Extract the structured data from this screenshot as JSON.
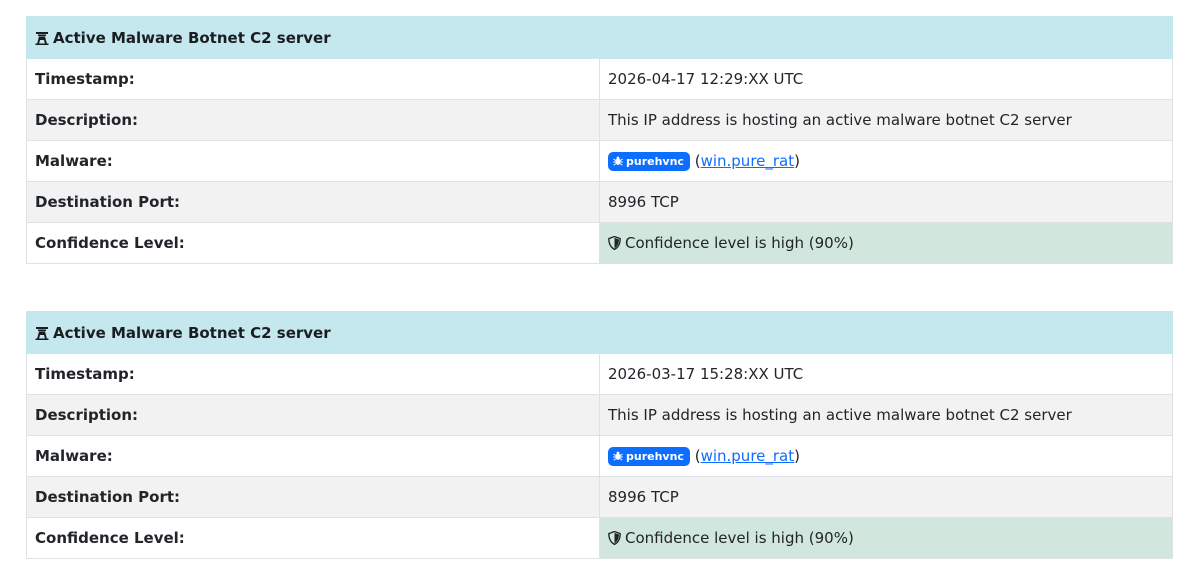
{
  "entries": [
    {
      "title": "Active Malware Botnet C2 server",
      "header_icon": "broadcast-tower-icon",
      "timestamp_label": "Timestamp:",
      "timestamp": "2026-04-17 12:29:XX UTC",
      "description_label": "Description:",
      "description": "This IP address is hosting an active malware botnet C2 server",
      "malware_label": "Malware:",
      "malware_badge": "purehvnc",
      "malware_badge_icon": "bug-icon",
      "malware_link": "win.pure_rat",
      "port_label": "Destination Port:",
      "port": "8996 TCP",
      "confidence_label": "Confidence Level:",
      "confidence_icon": "shield-icon",
      "confidence": "Confidence level is high (90%)"
    },
    {
      "title": "Active Malware Botnet C2 server",
      "header_icon": "broadcast-tower-icon",
      "timestamp_label": "Timestamp:",
      "timestamp": "2026-03-17 15:28:XX UTC",
      "description_label": "Description:",
      "description": "This IP address is hosting an active malware botnet C2 server",
      "malware_label": "Malware:",
      "malware_badge": "purehvnc",
      "malware_badge_icon": "bug-icon",
      "malware_link": "win.pure_rat",
      "port_label": "Destination Port:",
      "port": "8996 TCP",
      "confidence_label": "Confidence Level:",
      "confidence_icon": "shield-icon",
      "confidence": "Confidence level is high (90%)"
    }
  ],
  "colors": {
    "header_bg": "#c5e7ee",
    "alt_row_bg": "#f2f2f2",
    "confidence_bg": "#d1e7dd",
    "badge_bg": "#0d6efd",
    "link": "#0d6efd"
  }
}
